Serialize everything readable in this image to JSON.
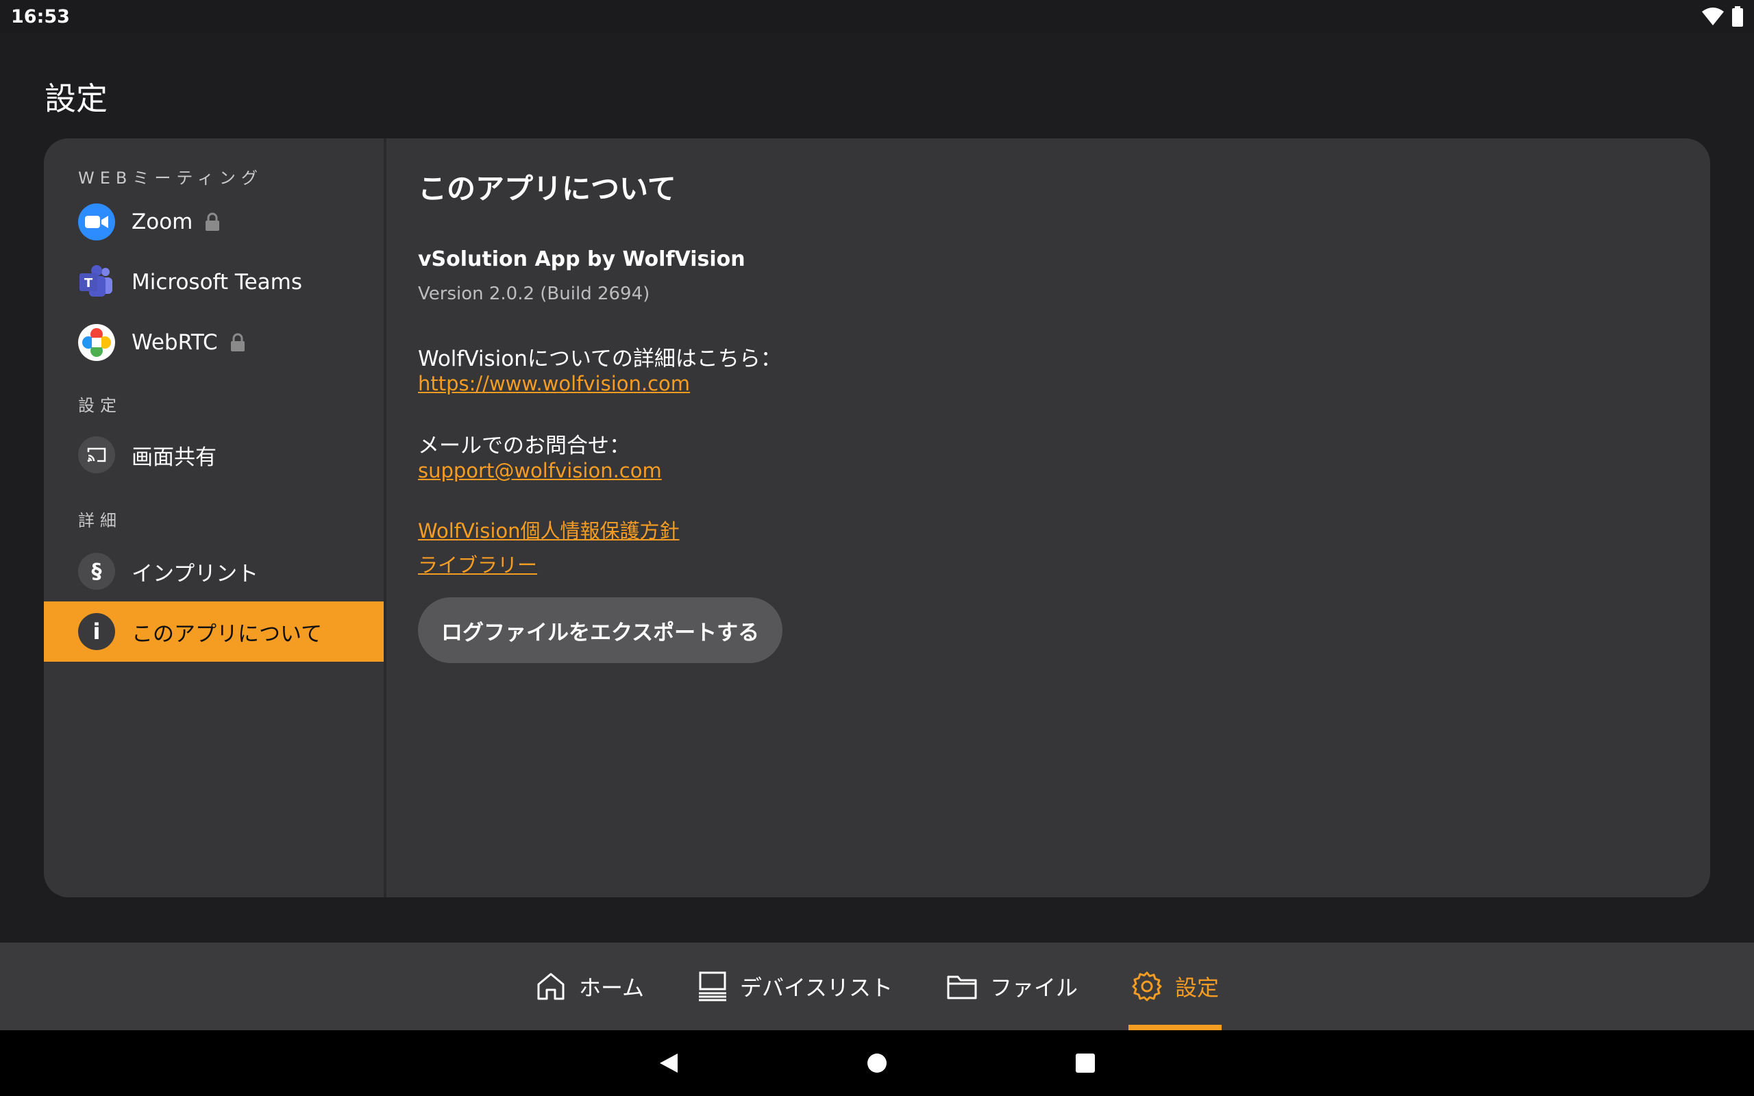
{
  "status": {
    "time": "16:53"
  },
  "page": {
    "title": "設定"
  },
  "sidebar": {
    "sections": [
      {
        "label": "WEBミーティング"
      },
      {
        "label": "設定"
      },
      {
        "label": "詳細"
      }
    ],
    "items": [
      {
        "label": "Zoom",
        "icon": "zoom-icon",
        "locked": true
      },
      {
        "label": "Microsoft Teams",
        "icon": "teams-icon",
        "locked": false
      },
      {
        "label": "WebRTC",
        "icon": "webrtc-icon",
        "locked": true
      },
      {
        "label": "画面共有",
        "icon": "cast-icon"
      },
      {
        "label": "インプリント",
        "icon": "section-icon",
        "glyph": "§"
      },
      {
        "label": "このアプリについて",
        "icon": "info-icon",
        "glyph": "i",
        "active": true
      }
    ]
  },
  "about": {
    "heading": "このアプリについて",
    "app_name": "vSolution App by WolfVision",
    "version": "Version 2.0.2 (Build 2694)",
    "more_info_label": "WolfVisionについての詳細はこちら：",
    "website": "https://www.wolfvision.com",
    "contact_label": "メールでのお問合せ：",
    "email": "support@wolfvision.com",
    "privacy_link": "WolfVision個人情報保護方針",
    "library_link": "ライブラリー",
    "export_button": "ログファイルをエクスポートする"
  },
  "bottom_nav": [
    {
      "label": "ホーム",
      "icon": "home-icon"
    },
    {
      "label": "デバイスリスト",
      "icon": "device-list-icon"
    },
    {
      "label": "ファイル",
      "icon": "folder-icon"
    },
    {
      "label": "設定",
      "icon": "gear-icon",
      "active": true
    }
  ],
  "colors": {
    "accent": "#f59c23",
    "panel": "#363638",
    "background": "#1d1d1f"
  }
}
